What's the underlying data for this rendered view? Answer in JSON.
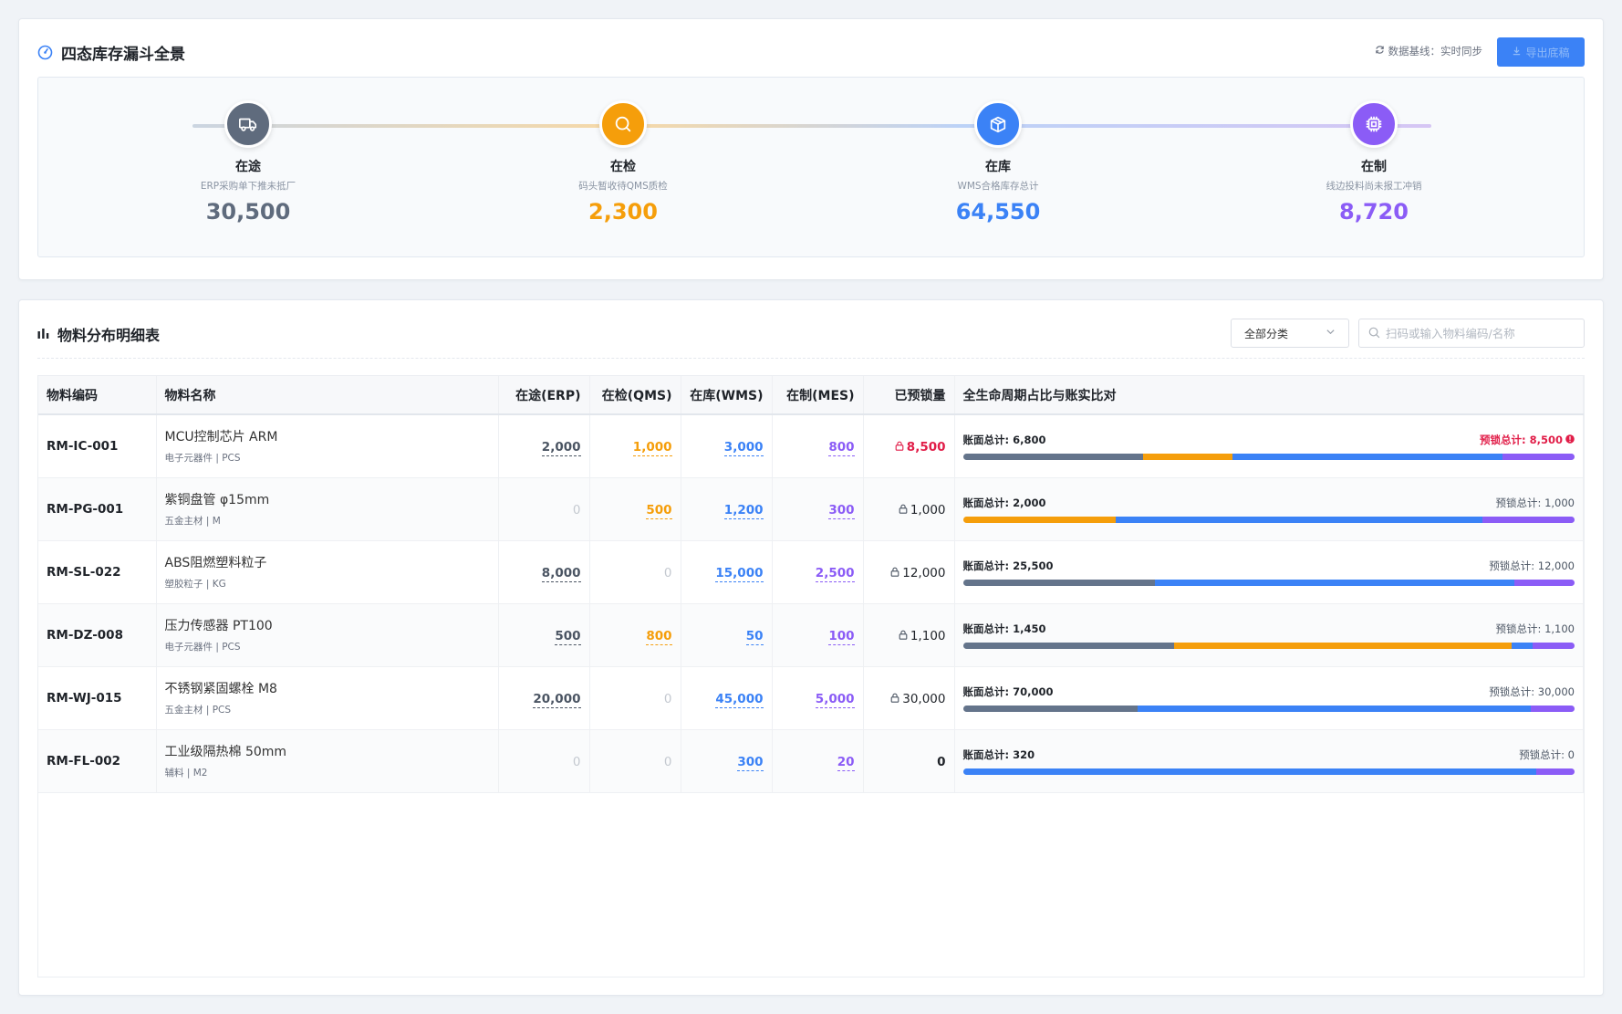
{
  "funnel": {
    "title": "四态库存漏斗全景",
    "sync_text": "数据基线：实时同步",
    "export_label": "导出底稿",
    "stages": [
      {
        "name": "在途",
        "desc": "ERP采购单下推未抵厂",
        "value": "30,500",
        "color": "#5f6b7d",
        "icon": "truck-icon"
      },
      {
        "name": "在检",
        "desc": "码头暂收待QMS质检",
        "value": "2,300",
        "color": "#f59e0b",
        "icon": "search-icon"
      },
      {
        "name": "在库",
        "desc": "WMS合格库存总计",
        "value": "64,550",
        "color": "#3b82f6",
        "icon": "box-icon"
      },
      {
        "name": "在制",
        "desc": "线边投料尚未报工冲销",
        "value": "8,720",
        "color": "#8b5cf6",
        "icon": "chip-icon"
      }
    ]
  },
  "table": {
    "title": "物料分布明细表",
    "filter_value": "全部分类",
    "search_placeholder": "扫码或输入物料编码/名称",
    "headers": {
      "code": "物料编码",
      "name": "物料名称",
      "erp": "在途(ERP)",
      "qms": "在检(QMS)",
      "wms": "在库(WMS)",
      "mes": "在制(MES)",
      "locked": "已预锁量",
      "life": "全生命周期占比与账实比对"
    },
    "rows": [
      {
        "code": "RM-IC-001",
        "name": "MCU控制芯片 ARM",
        "sub": "电子元器件 | PCS",
        "erp": "2,000",
        "qms": "1,000",
        "wms": "3,000",
        "mes": "800",
        "locked": "8,500",
        "book": "账面总计: 6,800",
        "lock_total": "预锁总计: 8,500",
        "alert": true,
        "shares": {
          "erp": 2000,
          "qms": 1000,
          "wms": 3000,
          "mes": 800
        }
      },
      {
        "code": "RM-PG-001",
        "name": "紫铜盘管 φ15mm",
        "sub": "五金主材 | M",
        "erp": "0",
        "qms": "500",
        "wms": "1,200",
        "mes": "300",
        "locked": "1,000",
        "book": "账面总计: 2,000",
        "lock_total": "预锁总计: 1,000",
        "alert": false,
        "shares": {
          "erp": 0,
          "qms": 500,
          "wms": 1200,
          "mes": 300
        }
      },
      {
        "code": "RM-SL-022",
        "name": "ABS阻燃塑料粒子",
        "sub": "塑胶粒子 | KG",
        "erp": "8,000",
        "qms": "0",
        "wms": "15,000",
        "mes": "2,500",
        "locked": "12,000",
        "book": "账面总计: 25,500",
        "lock_total": "预锁总计: 12,000",
        "alert": false,
        "shares": {
          "erp": 8000,
          "qms": 0,
          "wms": 15000,
          "mes": 2500
        }
      },
      {
        "code": "RM-DZ-008",
        "name": "压力传感器 PT100",
        "sub": "电子元器件 | PCS",
        "erp": "500",
        "qms": "800",
        "wms": "50",
        "mes": "100",
        "locked": "1,100",
        "book": "账面总计: 1,450",
        "lock_total": "预锁总计: 1,100",
        "alert": false,
        "shares": {
          "erp": 500,
          "qms": 800,
          "wms": 50,
          "mes": 100
        }
      },
      {
        "code": "RM-WJ-015",
        "name": "不锈钢紧固螺栓 M8",
        "sub": "五金主材 | PCS",
        "erp": "20,000",
        "qms": "0",
        "wms": "45,000",
        "mes": "5,000",
        "locked": "30,000",
        "book": "账面总计: 70,000",
        "lock_total": "预锁总计: 30,000",
        "alert": false,
        "shares": {
          "erp": 20000,
          "qms": 0,
          "wms": 45000,
          "mes": 5000
        }
      },
      {
        "code": "RM-FL-002",
        "name": "工业级隔热棉 50mm",
        "sub": "辅料 | M2",
        "erp": "0",
        "qms": "0",
        "wms": "300",
        "mes": "20",
        "locked": "0",
        "book": "账面总计: 320",
        "lock_total": "预锁总计: 0",
        "alert": false,
        "shares": {
          "erp": 0,
          "qms": 0,
          "wms": 300,
          "mes": 20
        }
      }
    ]
  }
}
